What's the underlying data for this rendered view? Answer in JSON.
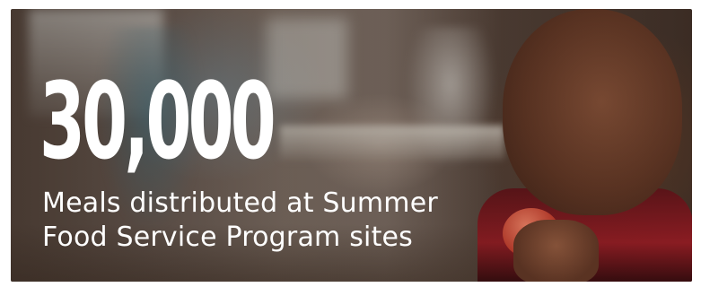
{
  "stat": {
    "value": "30,000",
    "caption_line_1": "Meals distributed at Summer",
    "caption_line_2": "Food Service Program sites"
  },
  "colors": {
    "text": "#ffffff",
    "shirt_red": "#8a1c22"
  }
}
